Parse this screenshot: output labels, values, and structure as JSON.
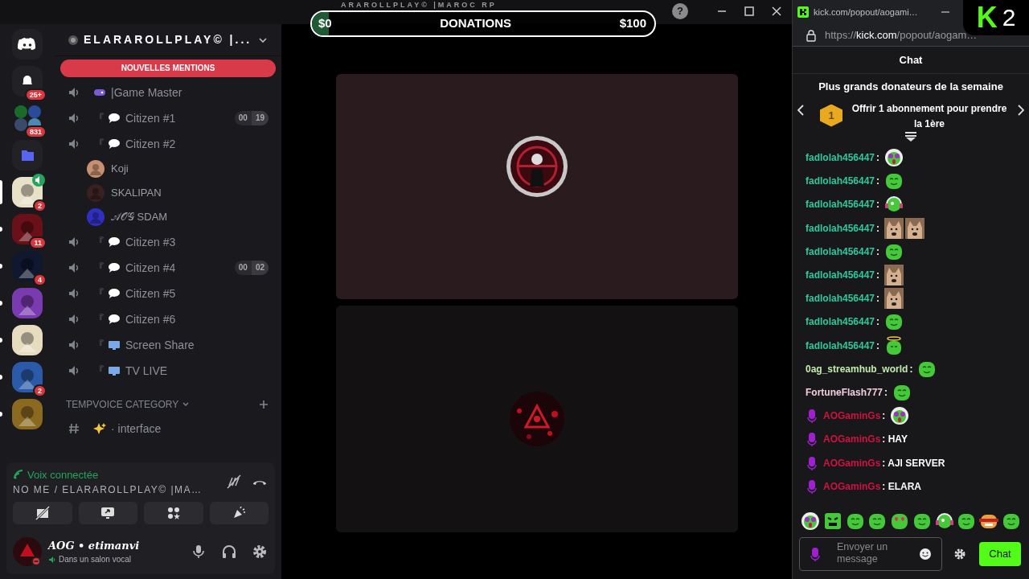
{
  "app_window": {
    "title": "ARAROLLPLAY© |MAROC RP",
    "help": "?"
  },
  "server_rail": [
    {
      "kind": "discord",
      "selected": false
    },
    {
      "kind": "inbox",
      "badge": "25+",
      "selected": false
    },
    {
      "kind": "group",
      "badge": "831",
      "selected": false
    },
    {
      "kind": "folder",
      "selected": false
    },
    {
      "kind": "server",
      "color": "#e8e0c8",
      "badge": "2",
      "voice": true,
      "selected": true
    },
    {
      "kind": "server",
      "color": "#6a1018",
      "badge": "11",
      "voice": false,
      "selected": false
    },
    {
      "kind": "server",
      "color": "#101830",
      "badge": "4",
      "voice": false,
      "selected": false
    },
    {
      "kind": "server",
      "color": "#7a3ab0",
      "voice": false,
      "selected": false
    },
    {
      "kind": "server",
      "color": "#e8dcc0",
      "voice": false,
      "selected": false
    },
    {
      "kind": "server",
      "color": "#2a5aa8",
      "badge": "2",
      "voice": false,
      "selected": false
    },
    {
      "kind": "server",
      "color": "#8a6a20",
      "voice": false,
      "selected": false
    }
  ],
  "server": {
    "name": "ELARAROLLPLAY© |..."
  },
  "mentions_banner": "NOUVELLES MENTIONS",
  "channels": [
    {
      "kind": "voice-gamepad",
      "name": "|Game Master"
    },
    {
      "kind": "voice-chat",
      "prefix": "『",
      "name": "Citizen #1",
      "timer": [
        "00",
        "19"
      ]
    },
    {
      "kind": "voice-chat",
      "prefix": "『",
      "name": "Citizen #2",
      "children": [
        {
          "name": "Koji"
        },
        {
          "name": "SKALIPAN"
        },
        {
          "name": "𝒜𝒪𝒢 SDAM"
        }
      ]
    },
    {
      "kind": "voice-chat",
      "prefix": "『",
      "name": "Citizen #3"
    },
    {
      "kind": "voice-chat",
      "prefix": "『",
      "name": "Citizen #4",
      "timer": [
        "00",
        "02"
      ]
    },
    {
      "kind": "voice-chat",
      "prefix": "『",
      "name": "Citizen #5"
    },
    {
      "kind": "voice-chat",
      "prefix": "『",
      "name": "Citizen #6"
    },
    {
      "kind": "voice-screen",
      "prefix": "『",
      "name": "Screen Share"
    },
    {
      "kind": "voice-screen",
      "prefix": "『",
      "name": "TV LIVE"
    }
  ],
  "category": {
    "title": "TEMPVOICE CATEGORY",
    "channels": [
      {
        "kind": "text-sparkles",
        "name": "· interface"
      }
    ]
  },
  "voice_panel": {
    "status": "Voix connectée",
    "channel": "NO ME / ELARAROLLPLAY© |MA…"
  },
  "user_panel": {
    "name": "AOG • etimanvi",
    "status": "Dans un salon vocal"
  },
  "donation_bar": {
    "left": "$0",
    "title": "DONATIONS",
    "right": "$100",
    "level": 0.05
  },
  "browser": {
    "tab_title": "kick.com/popout/aogami…",
    "url_prefix": "https://",
    "url_host": "kick.com",
    "url_path": "/popout/aogam…"
  },
  "overlay_logo": {
    "letter": "K",
    "number": "2"
  },
  "chat": {
    "title": "Chat",
    "leaderboard_title": "Plus grands donateurs de la semaine",
    "rank": "1",
    "leaderboard_text": "Offrir 1 abonnement pour prendre la 1ère",
    "messages": [
      {
        "user": "fadlolah456447",
        "color": "#2ec99a",
        "text": ":",
        "emotes": [
          {
            "kind": "skull"
          }
        ],
        "badge": false
      },
      {
        "user": "fadlolah456447",
        "color": "#2ec99a",
        "text": ":",
        "emotes": [
          {
            "kind": "smile"
          }
        ],
        "badge": false
      },
      {
        "user": "fadlolah456447",
        "color": "#2ec99a",
        "text": ":",
        "emotes": [
          {
            "kind": "headphone"
          }
        ],
        "badge": false
      },
      {
        "user": "fadlolah456447",
        "color": "#2ec99a",
        "text": ":",
        "emotes": [
          {
            "kind": "cat"
          },
          {
            "kind": "cat"
          }
        ],
        "badge": false
      },
      {
        "user": "fadlolah456447",
        "color": "#2ec99a",
        "text": ":",
        "emotes": [
          {
            "kind": "smile"
          }
        ],
        "badge": false
      },
      {
        "user": "fadlolah456447",
        "color": "#2ec99a",
        "text": ":",
        "emotes": [
          {
            "kind": "cat"
          }
        ],
        "badge": false
      },
      {
        "user": "fadlolah456447",
        "color": "#2ec99a",
        "text": ":",
        "emotes": [
          {
            "kind": "cat"
          }
        ],
        "badge": false
      },
      {
        "user": "fadlolah456447",
        "color": "#2ec99a",
        "text": ":",
        "emotes": [
          {
            "kind": "smile"
          }
        ],
        "badge": false
      },
      {
        "user": "fadlolah456447",
        "color": "#2ec99a",
        "text": ":",
        "emotes": [
          {
            "kind": "halo"
          }
        ],
        "badge": false
      },
      {
        "user": "0ag_streamhub_world",
        "color": "#c0ecaa",
        "text": ":",
        "emotes": [
          {
            "kind": "smile"
          }
        ],
        "badge": false
      },
      {
        "user": "FortuneFlash777",
        "color": "#f2cede",
        "text": ":",
        "emotes": [
          {
            "kind": "smile"
          }
        ],
        "badge": false
      },
      {
        "user": "AOGaminGs",
        "color": "#d0123f",
        "text": ":",
        "emotes": [
          {
            "kind": "skull"
          }
        ],
        "badge": true
      },
      {
        "user": "AOGaminGs",
        "color": "#d0123f",
        "text": ": HAY",
        "badge": true
      },
      {
        "user": "AOGaminGs",
        "color": "#d0123f",
        "text": ": AJI SERVER",
        "badge": true
      },
      {
        "user": "AOGaminGs",
        "color": "#d0123f",
        "text": ": ELARA",
        "badge": true
      }
    ],
    "emote_row": [
      {
        "kind": "skull"
      },
      {
        "kind": "angry"
      },
      {
        "kind": "smile"
      },
      {
        "kind": "smile"
      },
      {
        "kind": "heart"
      },
      {
        "kind": "smile"
      },
      {
        "kind": "headphone"
      },
      {
        "kind": "smile"
      },
      {
        "kind": "red"
      },
      {
        "kind": "smile"
      }
    ],
    "input": {
      "placeholder": "Envoyer un message"
    },
    "send": "Chat"
  }
}
